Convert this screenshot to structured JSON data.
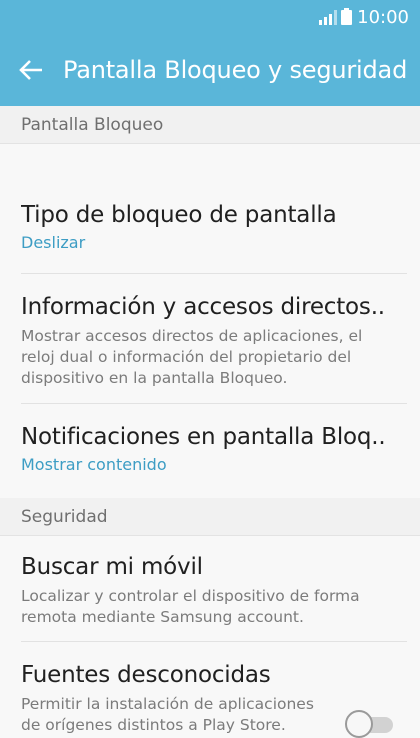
{
  "status_bar": {
    "time": "10:00",
    "icons": [
      "signal-icon",
      "battery-icon"
    ]
  },
  "header": {
    "back_icon": "arrow-left-icon",
    "title": "Pantalla Bloqueo y seguridad"
  },
  "sections": {
    "lock_screen": {
      "header": "Pantalla Bloqueo",
      "items": [
        {
          "title": "Tipo de bloqueo de pantalla",
          "value": "Deslizar"
        },
        {
          "title": "Información y accesos directos..",
          "description": "Mostrar accesos directos de aplicaciones, el reloj dual o información del propietario del dispositivo en la pantalla Bloqueo."
        },
        {
          "title": "Notificaciones en pantalla Bloq..",
          "value": "Mostrar contenido"
        }
      ]
    },
    "security": {
      "header": "Seguridad",
      "items": [
        {
          "title": "Buscar mi móvil",
          "description": "Localizar y controlar el dispositivo de forma remota mediante Samsung account."
        },
        {
          "title": "Fuentes desconocidas",
          "description": "Permitir la instalación de aplicaciones de orígenes distintos a Play Store.",
          "toggle_on": false
        }
      ]
    }
  },
  "colors": {
    "accent": "#5ab6d9",
    "link": "#3d9dc4"
  }
}
